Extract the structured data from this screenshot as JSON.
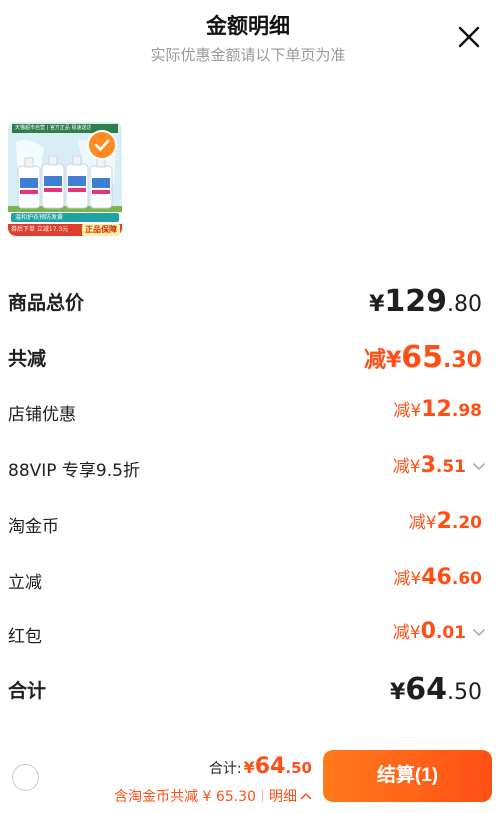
{
  "header": {
    "title": "金额明细",
    "subtitle": "实际优惠金额请以下单页为准"
  },
  "product": {
    "thumb_top_text": "天猫超市自营 | 官方正品 极速送达",
    "thumb_caption": "温和护衣预防发黄",
    "thumb_promo": "券后下单 立减17.3元",
    "thumb_guarantee": "正品保障"
  },
  "rows": [
    {
      "label": "商品总价",
      "prefix": "¥",
      "int": "129",
      "dec": ".80"
    },
    {
      "label": "共减",
      "prefix": "减¥",
      "int": "65",
      "dec": ".30"
    },
    {
      "label": "店铺优惠",
      "prefix": "减¥",
      "int": "12",
      "dec": ".98"
    },
    {
      "label": "88VIP 专享9.5折",
      "prefix": "减¥",
      "int": "3",
      "dec": ".51"
    },
    {
      "label": "淘金币",
      "prefix": "减¥",
      "int": "2",
      "dec": ".20"
    },
    {
      "label": "立减",
      "prefix": "减¥",
      "int": "46",
      "dec": ".60"
    },
    {
      "label": "红包",
      "prefix": "减¥",
      "int": "0",
      "dec": ".01"
    },
    {
      "label": "合计",
      "prefix": "¥",
      "int": "64",
      "dec": ".50"
    }
  ],
  "footer": {
    "total_label": "合计:",
    "total_yen": "¥",
    "total_int": "64",
    "total_dec": ".50",
    "saving_text": "含淘金币共减 ¥ 65.30",
    "detail_label": "明细",
    "checkout_label": "结算(1)"
  },
  "colors": {
    "accent": "#ff4f16",
    "accent_light": "#ff7a1a",
    "text": "#1f1f1f",
    "muted": "#9a9a9a"
  },
  "icons": {
    "close": "close-icon",
    "check": "check-icon",
    "chevron": "chevron-down-icon",
    "up": "chevron-up-icon"
  }
}
